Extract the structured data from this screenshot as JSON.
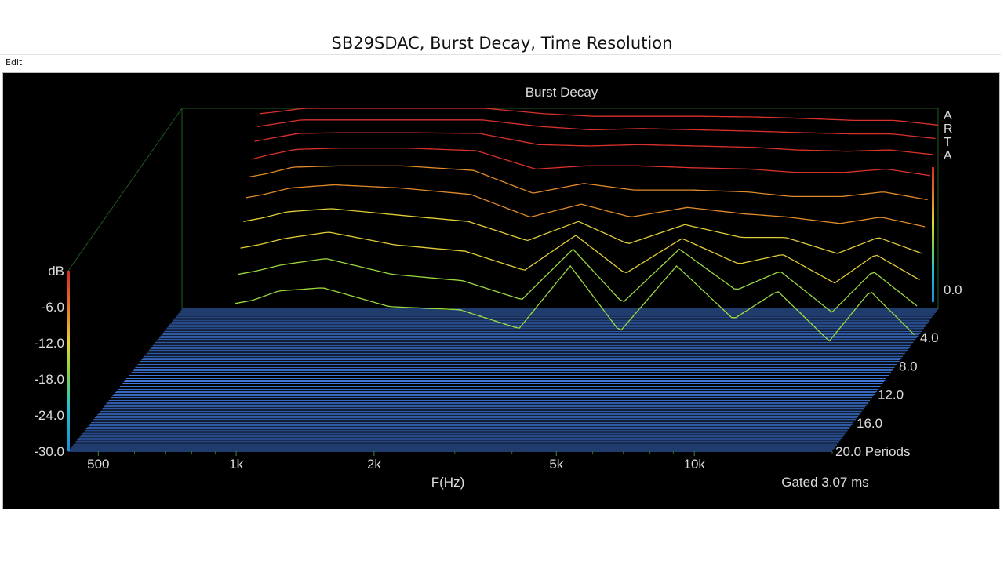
{
  "page": {
    "title": "SB29SDAC, Burst Decay, Time Resolution"
  },
  "menu": {
    "edit_label": "Edit"
  },
  "colors": {
    "background": "#000000",
    "floor": "#3f77d8",
    "grid": "#1e5a1e",
    "text": "#dddddd"
  },
  "chart_data": {
    "type": "waterfall",
    "title": "Burst Decay",
    "watermark": [
      "A",
      "R",
      "T",
      "A"
    ],
    "xlabel": "F(Hz)",
    "xscale": "log",
    "x_ticks": [
      "500",
      "1k",
      "2k",
      "5k",
      "10k"
    ],
    "db_axis_label": "dB",
    "db_ticks": [
      "-6.0",
      "-12.0",
      "-18.0",
      "-24.0",
      "-30.0"
    ],
    "db_range": [
      -30,
      0
    ],
    "top_level_label": "0.0",
    "time_ticks": [
      "4.0",
      "8.0",
      "12.0",
      "16.0",
      "20.0 Periods"
    ],
    "time_range": [
      0,
      20
    ],
    "gate_label": "Gated 3.07 ms",
    "freq_range_hz": [
      430,
      20000
    ],
    "colormap": [
      "#2d5fd6",
      "#23b7d2",
      "#9bd83f",
      "#e0cc36",
      "#e08a2a",
      "#d8322a"
    ],
    "decay_series": [
      {
        "t": 0.0,
        "freq_hz": [
          640,
          700,
          800,
          1000,
          1400,
          2000,
          2700,
          3500,
          4500,
          6000,
          8000,
          10000,
          13000,
          16000,
          20000
        ],
        "db": [
          -0.8,
          -0.5,
          0,
          0,
          0,
          0,
          -0.8,
          -1.2,
          -1.2,
          -1.2,
          -1.3,
          -1.5,
          -1.8,
          -1.8,
          -2.5
        ]
      },
      {
        "t": 0.5,
        "freq_hz": [
          640,
          700,
          800,
          1000,
          1400,
          2000,
          2700,
          3500,
          4500,
          6000,
          8000,
          10000,
          13000,
          16000,
          20000
        ],
        "db": [
          -2,
          -1.6,
          -1,
          -1,
          -1,
          -1,
          -2,
          -2.5,
          -2.3,
          -2.5,
          -2.7,
          -2.9,
          -3.1,
          -3.1,
          -3.8
        ]
      },
      {
        "t": 1.0,
        "freq_hz": [
          640,
          700,
          800,
          1000,
          1400,
          2000,
          2700,
          3500,
          4500,
          6000,
          8000,
          10000,
          13000,
          16000,
          20000
        ],
        "db": [
          -3.5,
          -3,
          -2.3,
          -2.2,
          -2.2,
          -2.3,
          -4,
          -4.2,
          -4,
          -4.2,
          -4.4,
          -4.8,
          -5,
          -4.8,
          -5.5
        ]
      },
      {
        "t": 1.5,
        "freq_hz": [
          640,
          700,
          800,
          1000,
          1400,
          2000,
          2700,
          3500,
          4500,
          6000,
          8000,
          10000,
          13000,
          16000,
          20000
        ],
        "db": [
          -5.5,
          -4.8,
          -4,
          -3.8,
          -3.8,
          -4.2,
          -7,
          -6.5,
          -6.5,
          -6.8,
          -7,
          -7.5,
          -7.5,
          -7,
          -8
        ]
      },
      {
        "t": 2.0,
        "freq_hz": [
          640,
          700,
          800,
          1000,
          1400,
          2000,
          2700,
          3500,
          4500,
          6000,
          8000,
          10000,
          13000,
          16000,
          20000
        ],
        "db": [
          -7.5,
          -7,
          -6,
          -5.8,
          -5.8,
          -6.5,
          -10,
          -8.5,
          -9.5,
          -9.5,
          -9.8,
          -10.5,
          -10.5,
          -9.8,
          -11
        ]
      },
      {
        "t": 2.5,
        "freq_hz": [
          640,
          700,
          800,
          1000,
          1400,
          2000,
          2700,
          3500,
          4500,
          6000,
          8000,
          10000,
          13000,
          16000,
          20000
        ],
        "db": [
          -10,
          -9.5,
          -8.5,
          -8,
          -8.5,
          -9.5,
          -13,
          -11,
          -13,
          -11.5,
          -12.5,
          -13,
          -14,
          -13,
          -14.5
        ]
      },
      {
        "t": 3.0,
        "freq_hz": [
          640,
          700,
          800,
          1000,
          1400,
          2000,
          2700,
          3500,
          4500,
          6000,
          8000,
          10000,
          13000,
          16000,
          20000
        ],
        "db": [
          -13,
          -12.5,
          -11.5,
          -11,
          -12,
          -13,
          -16,
          -13,
          -16.5,
          -13.5,
          -15.5,
          -15.5,
          -18,
          -15.5,
          -18
        ]
      },
      {
        "t": 3.5,
        "freq_hz": [
          640,
          700,
          800,
          1000,
          1400,
          2000,
          2700,
          3500,
          4500,
          6000,
          8000,
          10000,
          13000,
          16000,
          20000
        ],
        "db": [
          -16.5,
          -16,
          -15,
          -14,
          -16,
          -17,
          -20,
          -14.5,
          -20.5,
          -15,
          -19,
          -17.5,
          -22,
          -17.5,
          -21.5
        ]
      },
      {
        "t": 4.0,
        "freq_hz": [
          640,
          700,
          800,
          1000,
          1400,
          2000,
          2700,
          3500,
          4500,
          6000,
          8000,
          10000,
          13000,
          16000,
          20000
        ],
        "db": [
          -20,
          -19.5,
          -18.5,
          -17.5,
          -20,
          -21,
          -24,
          -16,
          -24.5,
          -16,
          -22.5,
          -19.5,
          -26,
          -19.5,
          -25
        ]
      },
      {
        "t": 4.5,
        "freq_hz": [
          640,
          700,
          800,
          1000,
          1400,
          2000,
          2700,
          3500,
          4500,
          6000,
          8000,
          10000,
          13000,
          16000,
          20000
        ],
        "db": [
          -24,
          -23.5,
          -22,
          -21.5,
          -24.5,
          -25,
          -28,
          -18,
          -28.5,
          -18,
          -26.5,
          -22,
          -30,
          -22,
          -29
        ]
      }
    ]
  }
}
